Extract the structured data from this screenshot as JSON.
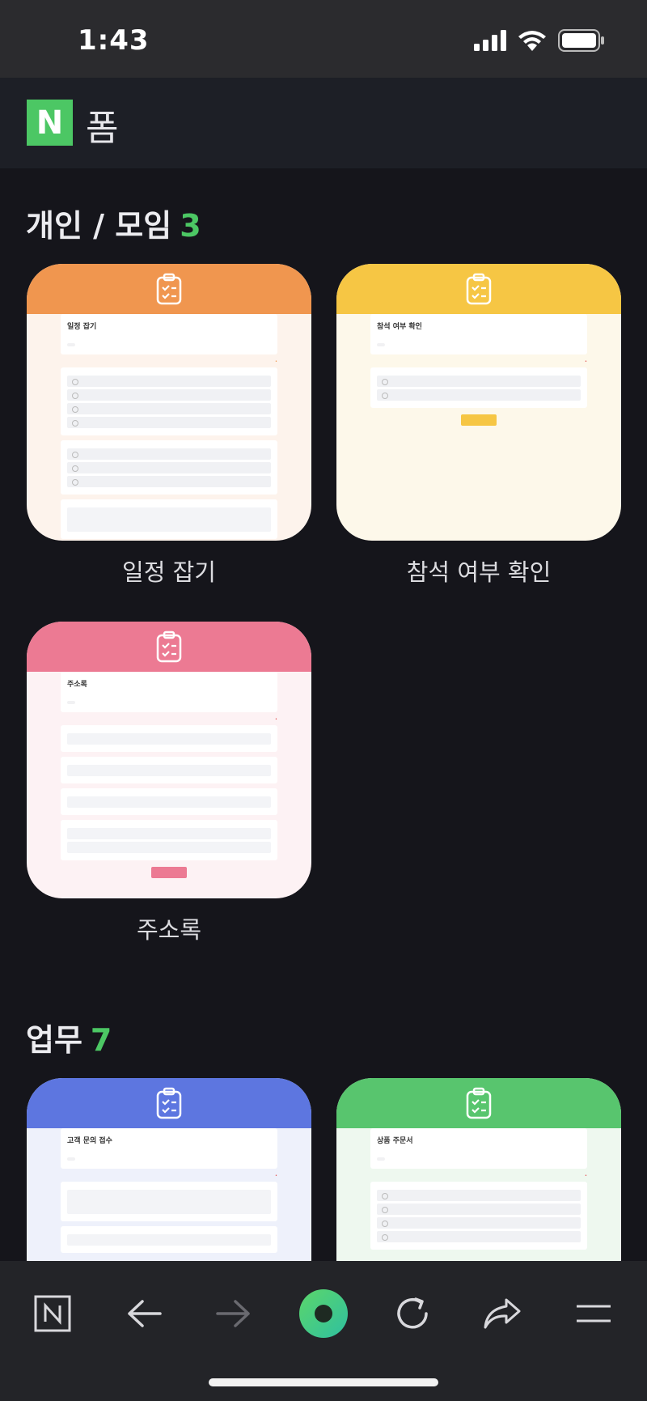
{
  "status_bar": {
    "time": "1:43"
  },
  "header": {
    "logo_letter": "N",
    "title": "폼"
  },
  "sections": [
    {
      "title": "개인 / 모임",
      "count": "3",
      "cards": [
        {
          "label": "일정 잡기",
          "color": "#f0964f",
          "bg": "#fdf3ec",
          "form_title": "일정 잡기"
        },
        {
          "label": "참석 여부 확인",
          "color": "#f6c644",
          "bg": "#fdf8ea",
          "form_title": "참석 여부 확인"
        },
        {
          "label": "주소록",
          "color": "#ec7a93",
          "bg": "#fdf2f4",
          "form_title": "주소록"
        }
      ]
    },
    {
      "title": "업무",
      "count": "7",
      "cards": [
        {
          "label": "고객 문의 접수",
          "color": "#5d76e0",
          "bg": "#eef1fb",
          "form_title": "고객 문의 접수"
        },
        {
          "label": "상품 주문서",
          "color": "#58c56e",
          "bg": "#eef8ef",
          "form_title": "상품 주문서"
        }
      ]
    }
  ],
  "toolbar": {
    "items": [
      "naver-home",
      "back",
      "forward",
      "green-dot",
      "reload",
      "share",
      "menu"
    ]
  },
  "colors": {
    "accent": "#4cc764",
    "background": "#15151b"
  }
}
